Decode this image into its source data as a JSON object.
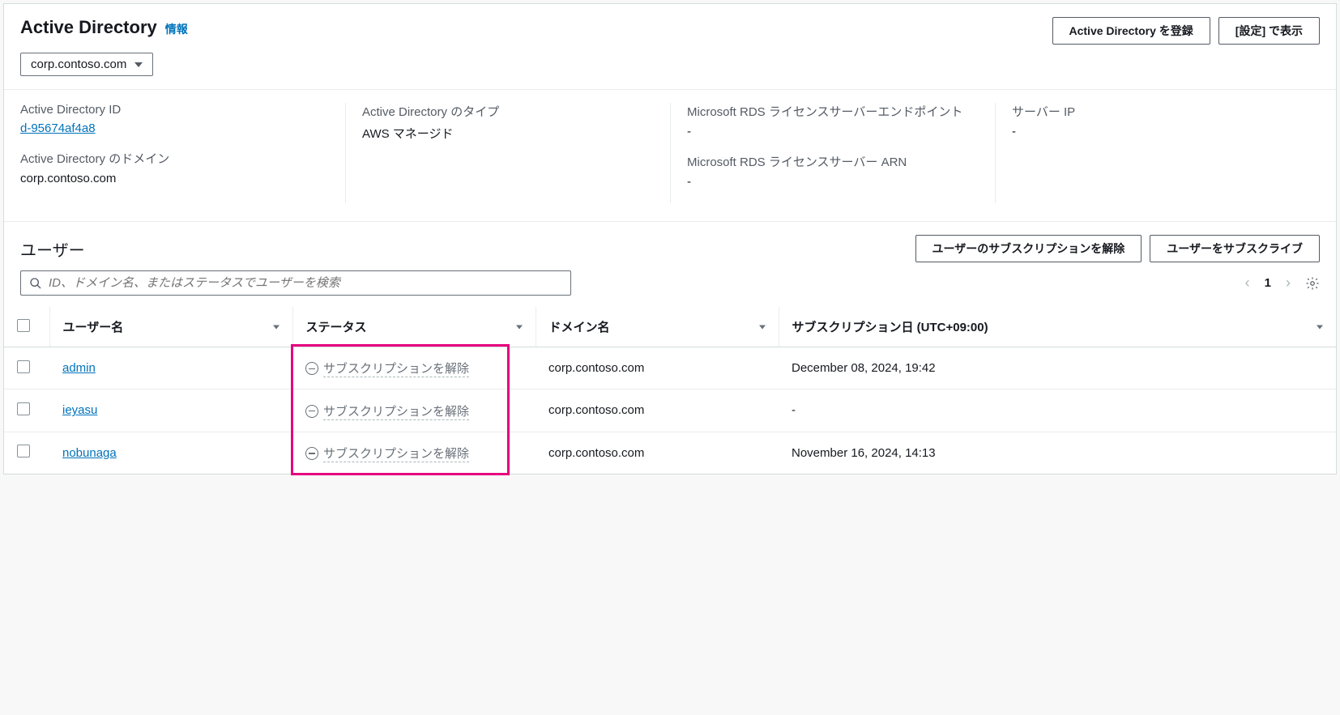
{
  "header": {
    "title": "Active Directory",
    "info_link": "情報",
    "register_button": "Active Directory を登録",
    "view_settings_button": "[設定] で表示",
    "domain_selected": "corp.contoso.com"
  },
  "info": {
    "ad_id_label": "Active Directory ID",
    "ad_id_value": "d-95674af4a8",
    "ad_domain_label": "Active Directory のドメイン",
    "ad_domain_value": "corp.contoso.com",
    "ad_type_label": "Active Directory のタイプ",
    "ad_type_value": "AWS マネージド",
    "rds_endpoint_label": "Microsoft RDS ライセンスサーバーエンドポイント",
    "rds_endpoint_value": "-",
    "rds_arn_label": "Microsoft RDS ライセンスサーバー ARN",
    "rds_arn_value": "-",
    "server_ip_label": "サーバー IP",
    "server_ip_value": "-"
  },
  "users_section": {
    "title": "ユーザー",
    "unsubscribe_button": "ユーザーのサブスクリプションを解除",
    "subscribe_button": "ユーザーをサブスクライブ",
    "search_placeholder": "ID、ドメイン名、またはステータスでユーザーを検索",
    "page_current": "1",
    "columns": {
      "username": "ユーザー名",
      "status": "ステータス",
      "domain": "ドメイン名",
      "sub_date": "サブスクリプション日 (UTC+09:00)"
    },
    "rows": [
      {
        "username": "admin",
        "status": "サブスクリプションを解除",
        "domain": "corp.contoso.com",
        "date": "December 08, 2024, 19:42"
      },
      {
        "username": "ieyasu",
        "status": "サブスクリプションを解除",
        "domain": "corp.contoso.com",
        "date": "-"
      },
      {
        "username": "nobunaga",
        "status": "サブスクリプションを解除",
        "domain": "corp.contoso.com",
        "date": "November 16, 2024, 14:13"
      }
    ]
  }
}
